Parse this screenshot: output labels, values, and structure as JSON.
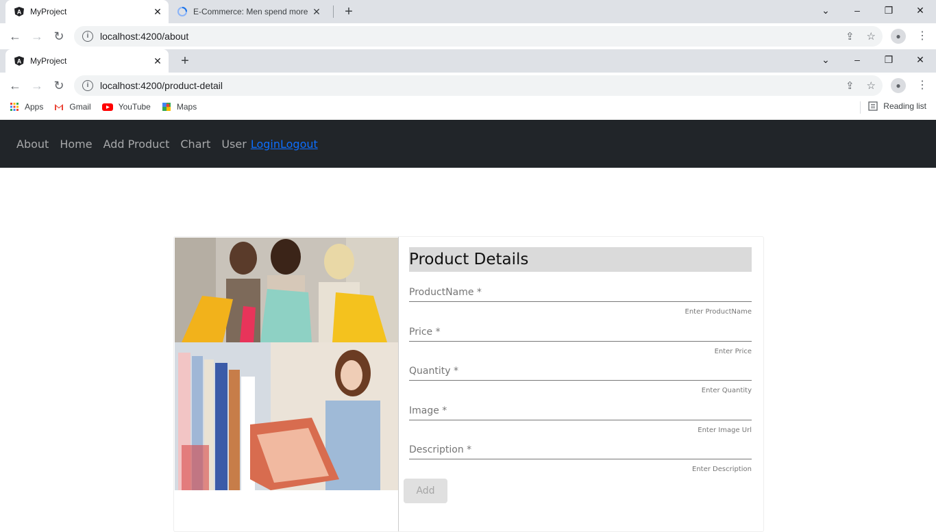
{
  "browser_back": {
    "tabs": [
      {
        "title": "MyProject",
        "close": "✕"
      },
      {
        "title": "E-Commerce: Men spend more th"
      }
    ],
    "url": "localhost:4200/about"
  },
  "browser_front": {
    "tabs": [
      {
        "title": "MyProject",
        "close": "✕"
      }
    ],
    "url": "localhost:4200/product-detail"
  },
  "window_controls": {
    "dropdown": "⌄",
    "minimize": "–",
    "restore": "❐",
    "close": "✕"
  },
  "bookmarks": [
    {
      "label": "Apps",
      "icon": "apps-grid-icon"
    },
    {
      "label": "Gmail",
      "icon": "gmail-icon"
    },
    {
      "label": "YouTube",
      "icon": "youtube-icon"
    },
    {
      "label": "Maps",
      "icon": "maps-icon"
    }
  ],
  "reading_list": "Reading list",
  "nav": {
    "links": [
      "About",
      "Home",
      "Add Product",
      "Chart",
      "User"
    ],
    "login": "Login",
    "logout": "Logout"
  },
  "form": {
    "title": "Product Details",
    "fields": [
      {
        "label": "ProductName *",
        "hint": "Enter ProductName"
      },
      {
        "label": "Price *",
        "hint": "Enter Price"
      },
      {
        "label": "Quantity *",
        "hint": "Enter Quantity"
      },
      {
        "label": "Image *",
        "hint": "Enter Image Url"
      },
      {
        "label": "Description *",
        "hint": "Enter Description"
      }
    ],
    "add_label": "Add"
  },
  "colors": {
    "navbar": "#212529",
    "link_blue": "#0d6efd",
    "heading_bg": "#dadada"
  }
}
